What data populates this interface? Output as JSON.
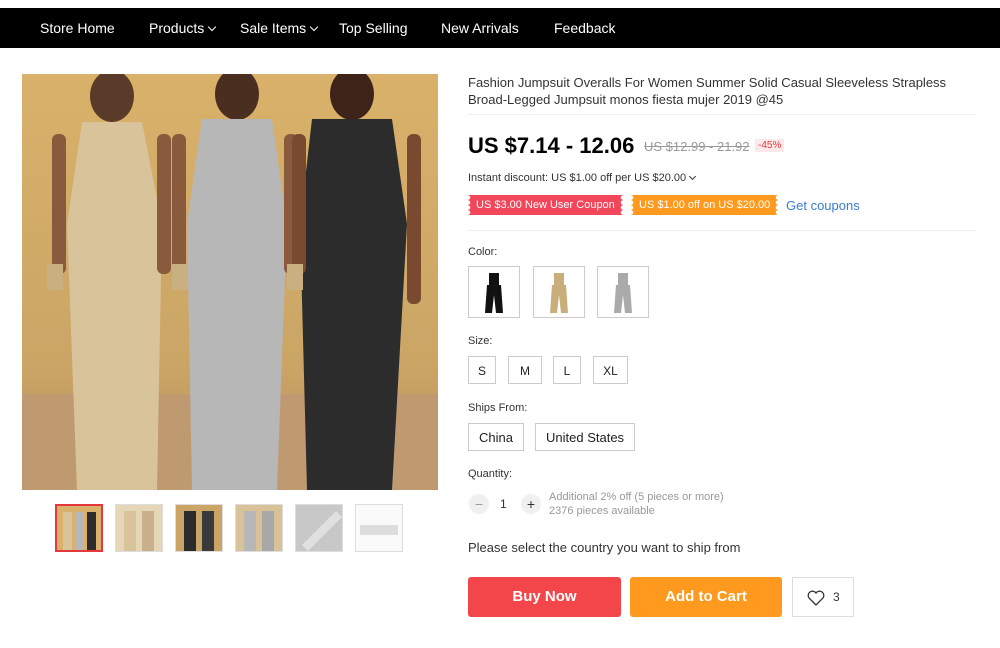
{
  "nav": {
    "items": [
      {
        "label": "Store Home",
        "dropdown": false
      },
      {
        "label": "Products",
        "dropdown": true
      },
      {
        "label": "Sale Items",
        "dropdown": true
      },
      {
        "label": "Top Selling",
        "dropdown": false
      },
      {
        "label": "New Arrivals",
        "dropdown": false
      },
      {
        "label": "Feedback",
        "dropdown": false
      }
    ]
  },
  "product": {
    "title": "Fashion Jumpsuit Overalls For Women Summer Solid Casual Sleeveless Strapless Broad-Legged Jumpsuit monos fiesta mujer 2019 @45",
    "price": "US $7.14 - 12.06",
    "old_price": "US $12.99 - 21.92",
    "discount": "-45%",
    "instant_discount": "Instant discount: US $1.00 off per US $20.00",
    "coupons": [
      "US $3.00 New User Coupon",
      "US $1.00 off on US $20.00"
    ],
    "get_coupons": "Get coupons"
  },
  "options": {
    "color_label": "Color:",
    "colors": [
      "black",
      "beige",
      "silver"
    ],
    "size_label": "Size:",
    "sizes": [
      "S",
      "M",
      "L",
      "XL"
    ],
    "ships_label": "Ships From:",
    "ships": [
      "China",
      "United States"
    ],
    "quantity_label": "Quantity:",
    "quantity": "1",
    "minus": "−",
    "plus": "+",
    "qty_note": "Additional 2% off (5 pieces or more)",
    "available": "2376 pieces available",
    "ship_note": "Please select the country you want to ship from"
  },
  "actions": {
    "buy": "Buy Now",
    "cart": "Add to Cart",
    "wish_count": "3"
  },
  "colors": {
    "nav_bg": "#000000",
    "buy": "#f3464a",
    "cart": "#ff9a1e",
    "coupon_red": "#f2475a",
    "coupon_orange": "#ff9a1f",
    "link": "#3a7bd5"
  }
}
